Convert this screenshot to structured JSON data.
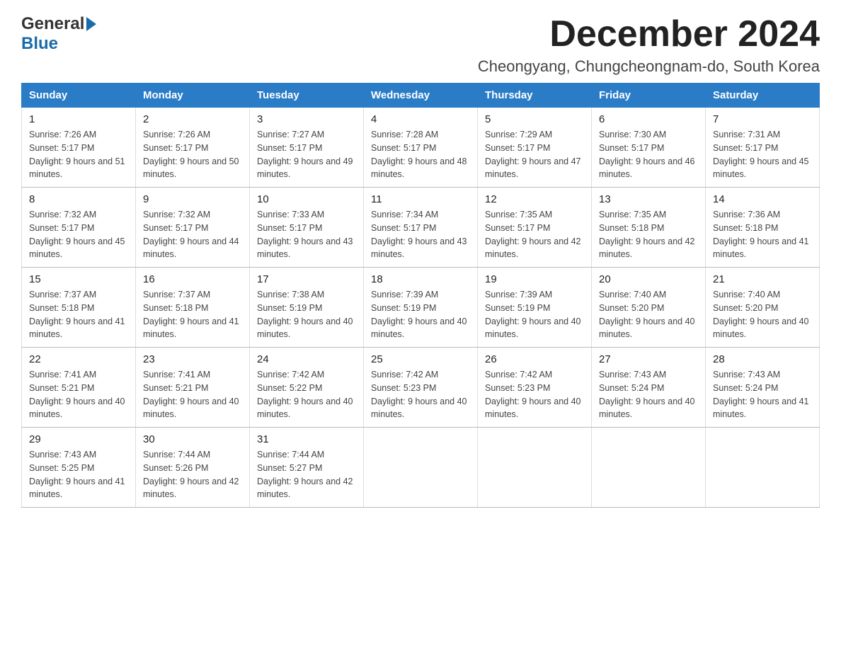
{
  "header": {
    "logo_general": "General",
    "logo_blue": "Blue",
    "month_title": "December 2024",
    "location": "Cheongyang, Chungcheongnam-do, South Korea"
  },
  "weekdays": [
    "Sunday",
    "Monday",
    "Tuesday",
    "Wednesday",
    "Thursday",
    "Friday",
    "Saturday"
  ],
  "weeks": [
    [
      {
        "day": "1",
        "sunrise": "7:26 AM",
        "sunset": "5:17 PM",
        "daylight": "9 hours and 51 minutes."
      },
      {
        "day": "2",
        "sunrise": "7:26 AM",
        "sunset": "5:17 PM",
        "daylight": "9 hours and 50 minutes."
      },
      {
        "day": "3",
        "sunrise": "7:27 AM",
        "sunset": "5:17 PM",
        "daylight": "9 hours and 49 minutes."
      },
      {
        "day": "4",
        "sunrise": "7:28 AM",
        "sunset": "5:17 PM",
        "daylight": "9 hours and 48 minutes."
      },
      {
        "day": "5",
        "sunrise": "7:29 AM",
        "sunset": "5:17 PM",
        "daylight": "9 hours and 47 minutes."
      },
      {
        "day": "6",
        "sunrise": "7:30 AM",
        "sunset": "5:17 PM",
        "daylight": "9 hours and 46 minutes."
      },
      {
        "day": "7",
        "sunrise": "7:31 AM",
        "sunset": "5:17 PM",
        "daylight": "9 hours and 45 minutes."
      }
    ],
    [
      {
        "day": "8",
        "sunrise": "7:32 AM",
        "sunset": "5:17 PM",
        "daylight": "9 hours and 45 minutes."
      },
      {
        "day": "9",
        "sunrise": "7:32 AM",
        "sunset": "5:17 PM",
        "daylight": "9 hours and 44 minutes."
      },
      {
        "day": "10",
        "sunrise": "7:33 AM",
        "sunset": "5:17 PM",
        "daylight": "9 hours and 43 minutes."
      },
      {
        "day": "11",
        "sunrise": "7:34 AM",
        "sunset": "5:17 PM",
        "daylight": "9 hours and 43 minutes."
      },
      {
        "day": "12",
        "sunrise": "7:35 AM",
        "sunset": "5:17 PM",
        "daylight": "9 hours and 42 minutes."
      },
      {
        "day": "13",
        "sunrise": "7:35 AM",
        "sunset": "5:18 PM",
        "daylight": "9 hours and 42 minutes."
      },
      {
        "day": "14",
        "sunrise": "7:36 AM",
        "sunset": "5:18 PM",
        "daylight": "9 hours and 41 minutes."
      }
    ],
    [
      {
        "day": "15",
        "sunrise": "7:37 AM",
        "sunset": "5:18 PM",
        "daylight": "9 hours and 41 minutes."
      },
      {
        "day": "16",
        "sunrise": "7:37 AM",
        "sunset": "5:18 PM",
        "daylight": "9 hours and 41 minutes."
      },
      {
        "day": "17",
        "sunrise": "7:38 AM",
        "sunset": "5:19 PM",
        "daylight": "9 hours and 40 minutes."
      },
      {
        "day": "18",
        "sunrise": "7:39 AM",
        "sunset": "5:19 PM",
        "daylight": "9 hours and 40 minutes."
      },
      {
        "day": "19",
        "sunrise": "7:39 AM",
        "sunset": "5:19 PM",
        "daylight": "9 hours and 40 minutes."
      },
      {
        "day": "20",
        "sunrise": "7:40 AM",
        "sunset": "5:20 PM",
        "daylight": "9 hours and 40 minutes."
      },
      {
        "day": "21",
        "sunrise": "7:40 AM",
        "sunset": "5:20 PM",
        "daylight": "9 hours and 40 minutes."
      }
    ],
    [
      {
        "day": "22",
        "sunrise": "7:41 AM",
        "sunset": "5:21 PM",
        "daylight": "9 hours and 40 minutes."
      },
      {
        "day": "23",
        "sunrise": "7:41 AM",
        "sunset": "5:21 PM",
        "daylight": "9 hours and 40 minutes."
      },
      {
        "day": "24",
        "sunrise": "7:42 AM",
        "sunset": "5:22 PM",
        "daylight": "9 hours and 40 minutes."
      },
      {
        "day": "25",
        "sunrise": "7:42 AM",
        "sunset": "5:23 PM",
        "daylight": "9 hours and 40 minutes."
      },
      {
        "day": "26",
        "sunrise": "7:42 AM",
        "sunset": "5:23 PM",
        "daylight": "9 hours and 40 minutes."
      },
      {
        "day": "27",
        "sunrise": "7:43 AM",
        "sunset": "5:24 PM",
        "daylight": "9 hours and 40 minutes."
      },
      {
        "day": "28",
        "sunrise": "7:43 AM",
        "sunset": "5:24 PM",
        "daylight": "9 hours and 41 minutes."
      }
    ],
    [
      {
        "day": "29",
        "sunrise": "7:43 AM",
        "sunset": "5:25 PM",
        "daylight": "9 hours and 41 minutes."
      },
      {
        "day": "30",
        "sunrise": "7:44 AM",
        "sunset": "5:26 PM",
        "daylight": "9 hours and 42 minutes."
      },
      {
        "day": "31",
        "sunrise": "7:44 AM",
        "sunset": "5:27 PM",
        "daylight": "9 hours and 42 minutes."
      },
      null,
      null,
      null,
      null
    ]
  ]
}
